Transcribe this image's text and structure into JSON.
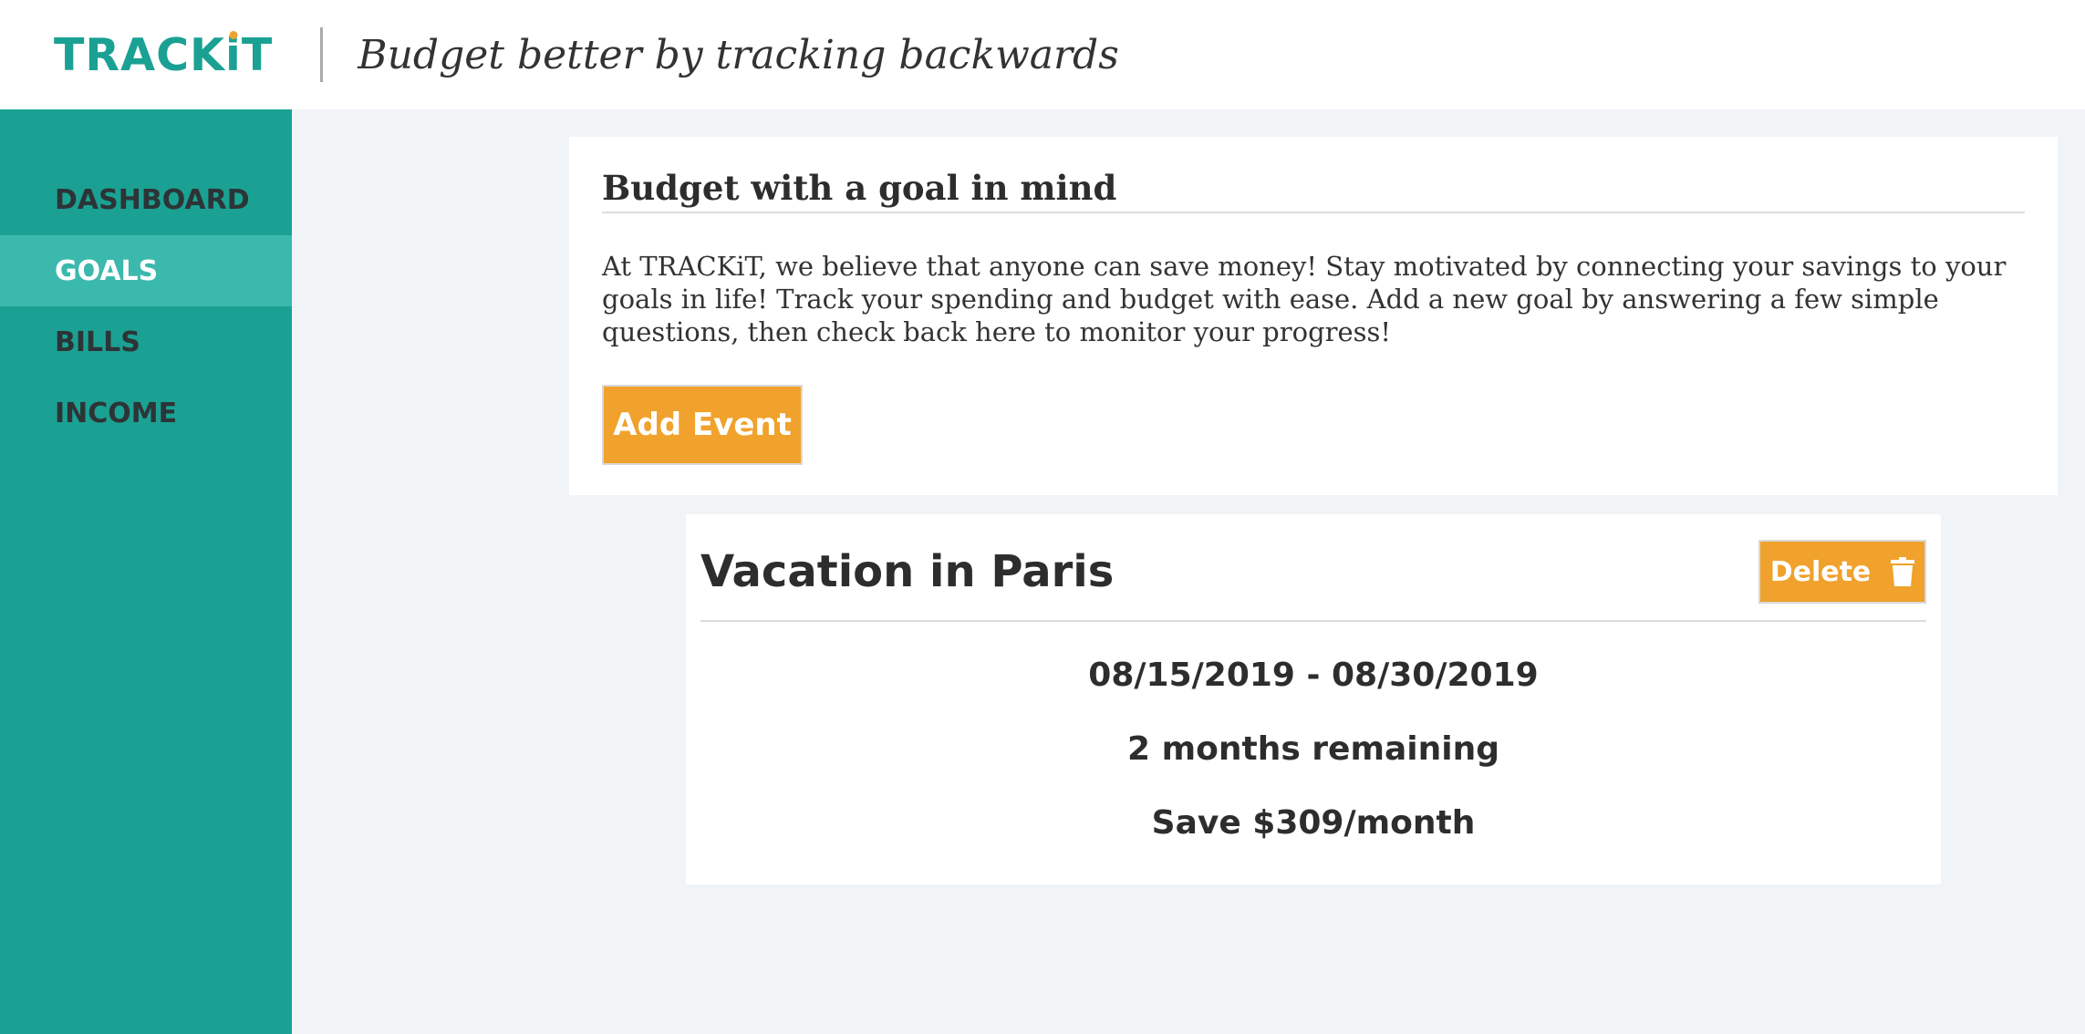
{
  "header": {
    "logo_prefix": "TRACK",
    "logo_i": "i",
    "logo_suffix": "T",
    "tagline": "Budget better by tracking backwards"
  },
  "sidebar": {
    "items": [
      {
        "label": "DASHBOARD",
        "active": false
      },
      {
        "label": "GOALS",
        "active": true
      },
      {
        "label": "BILLS",
        "active": false
      },
      {
        "label": "INCOME",
        "active": false
      }
    ]
  },
  "intro": {
    "title": "Budget with a goal in mind",
    "text": "At TRACKiT, we believe that anyone can save money! Stay motivated by connecting your savings to your goals in life! Track your spending and budget with ease. Add a new goal by answering a few simple questions, then check back here to monitor your progress!",
    "add_button": "Add Event"
  },
  "goal": {
    "title": "Vacation in Paris",
    "delete_label": "Delete",
    "delete_icon": "trash-icon",
    "dates": "08/15/2019 - 08/30/2019",
    "remaining": "2 months remaining",
    "save": "Save $309/month"
  },
  "colors": {
    "brand": "#1aa193",
    "active_nav": "#3bb9ad",
    "accent": "#f0a22c",
    "page_bg": "#f0f4f7"
  }
}
